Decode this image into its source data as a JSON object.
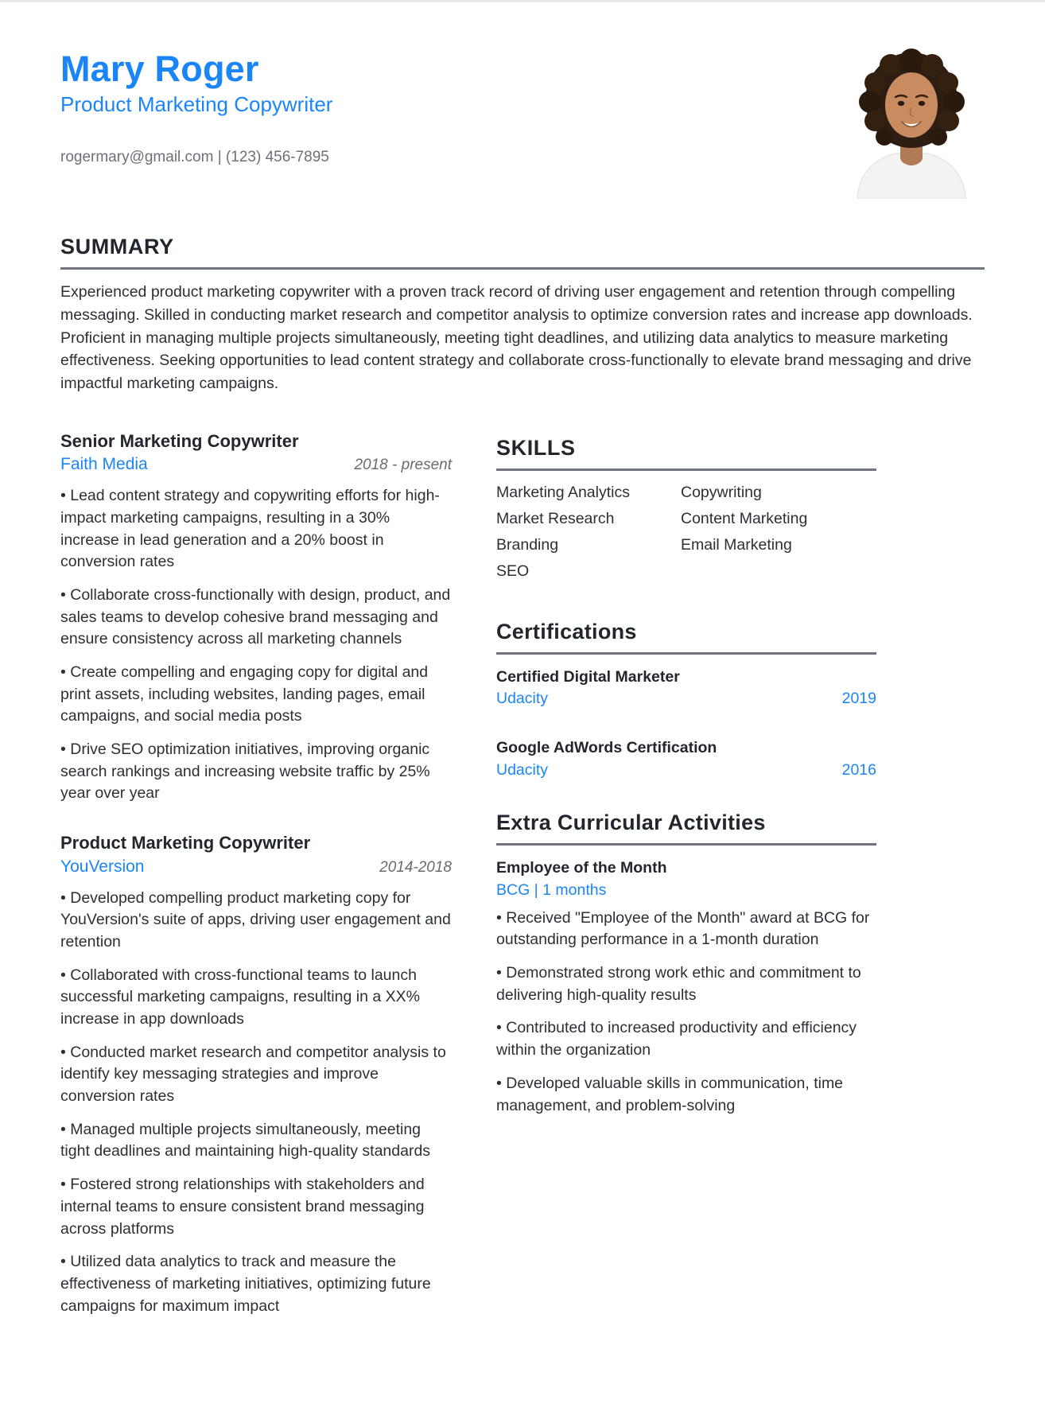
{
  "header": {
    "name": "Mary Roger",
    "job_title": "Product Marketing Copywriter",
    "contact": "rogermary@gmail.com | (123) 456-7895",
    "photo_alt": "profile-photo"
  },
  "colors": {
    "accent_blue": "#1a85f7",
    "heading_dark": "#22262d",
    "rule_gray": "#6f757e",
    "body_text": "#2b2f36",
    "muted_gray": "#6b7078"
  },
  "summary": {
    "heading": "SUMMARY",
    "text": "Experienced product marketing copywriter with a proven track record of driving user engagement and retention through compelling messaging. Skilled in conducting market research and competitor analysis to optimize conversion rates and increase app downloads. Proficient in managing multiple projects simultaneously, meeting tight deadlines, and utilizing data analytics to measure marketing effectiveness. Seeking opportunities to lead content strategy and collaborate cross-functionally to elevate brand messaging and drive impactful marketing campaigns."
  },
  "experience": [
    {
      "role": "Senior Marketing Copywriter",
      "company": "Faith Media",
      "dates": "2018 - present",
      "bullets": [
        "• Lead content strategy and copywriting efforts for high-impact marketing campaigns, resulting in a 30% increase in lead generation and a 20% boost in conversion rates",
        "• Collaborate cross-functionally with design, product, and sales teams to develop cohesive brand messaging and ensure consistency across all marketing channels",
        "• Create compelling and engaging copy for digital and print assets, including websites, landing pages, email campaigns, and social media posts",
        "• Drive SEO optimization initiatives, improving organic search rankings and increasing website traffic by 25% year over year"
      ]
    },
    {
      "role": "Product Marketing Copywriter",
      "company": "YouVersion",
      "dates": "2014-2018",
      "bullets": [
        "• Developed compelling product marketing copy for YouVersion's suite of apps, driving user engagement and retention",
        "• Collaborated with cross-functional teams to launch successful marketing campaigns, resulting in a XX% increase in app downloads",
        "• Conducted market research and competitor analysis to identify key messaging strategies and improve conversion rates",
        "• Managed multiple projects simultaneously, meeting tight deadlines and maintaining high-quality standards",
        "• Fostered strong relationships with stakeholders and internal teams to ensure consistent brand messaging across platforms",
        "• Utilized data analytics to track and measure the effectiveness of marketing initiatives, optimizing future campaigns for maximum impact"
      ]
    }
  ],
  "skills": {
    "heading": "SKILLS",
    "column_1": [
      "Marketing Analytics",
      "Market Research",
      "Branding",
      "SEO"
    ],
    "column_2": [
      "Copywriting",
      "Content Marketing",
      "Email Marketing"
    ]
  },
  "certifications": {
    "heading": "Certifications",
    "items": [
      {
        "name": "Certified Digital Marketer",
        "issuer": "Udacity",
        "year": "2019"
      },
      {
        "name": "Google AdWords Certification",
        "issuer": "Udacity",
        "year": "2016"
      }
    ]
  },
  "extra_curricular": {
    "heading": "Extra Curricular Activities",
    "items": [
      {
        "title": "Employee of the Month",
        "subtitle": "BCG | 1 months",
        "bullets": [
          "• Received \"Employee of the Month\" award at BCG for outstanding performance in a 1-month duration",
          "• Demonstrated strong work ethic and commitment to delivering high-quality results",
          "• Contributed to increased productivity and efficiency within the organization",
          "• Developed valuable skills in communication, time management, and problem-solving"
        ]
      }
    ]
  }
}
